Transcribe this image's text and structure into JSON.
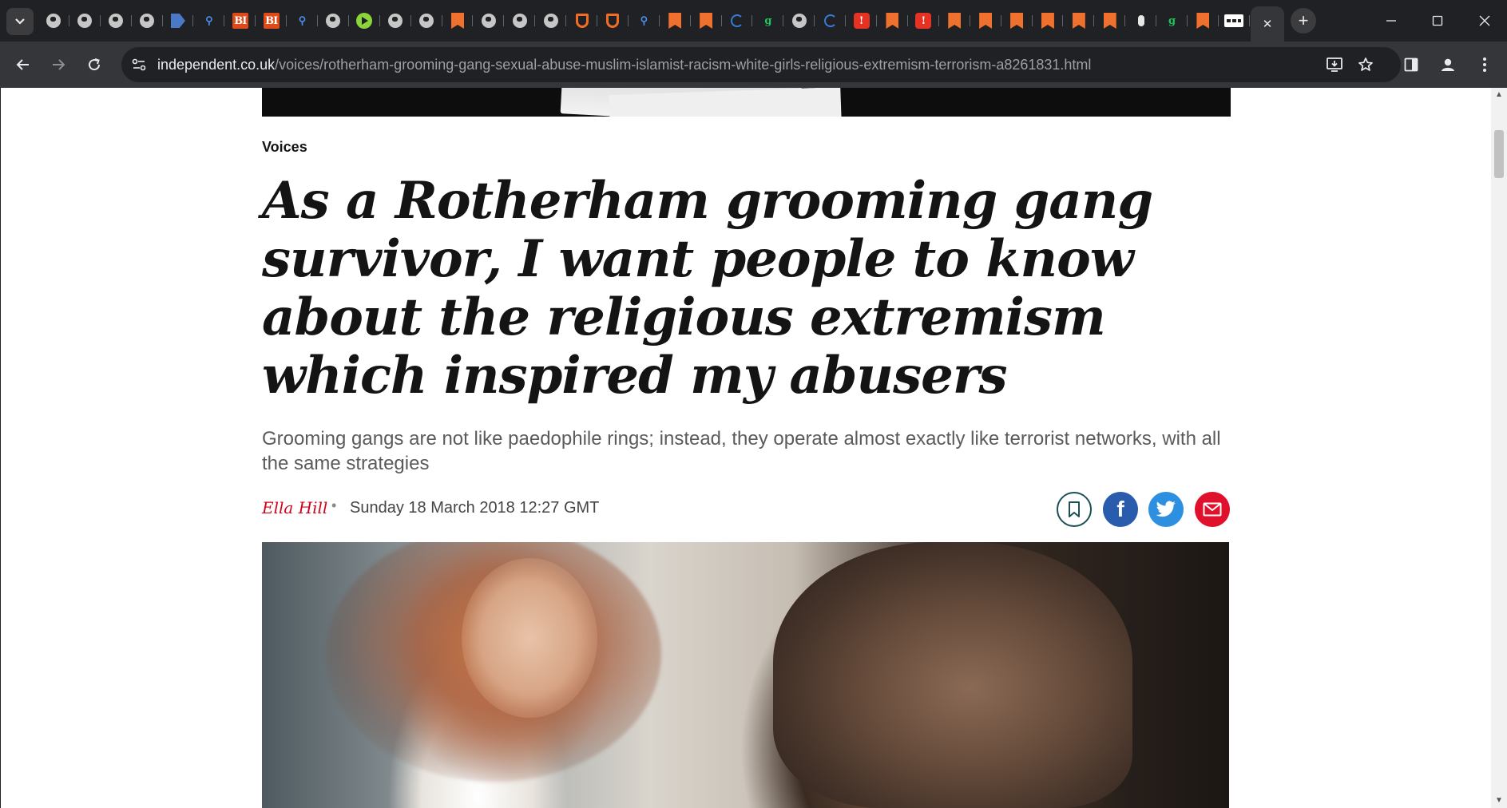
{
  "browser": {
    "pinned_tabs": [
      {
        "icon": "globe-icon"
      },
      {
        "icon": "globe-icon"
      },
      {
        "icon": "globe-icon"
      },
      {
        "icon": "globe-icon"
      },
      {
        "icon": "arrow-icon"
      },
      {
        "icon": "magnifier-icon"
      },
      {
        "icon": "bi-icon",
        "text": "BI"
      },
      {
        "icon": "bi-icon",
        "text": "BI"
      },
      {
        "icon": "magnifier-icon"
      },
      {
        "icon": "globe-icon"
      },
      {
        "icon": "play-icon"
      },
      {
        "icon": "globe-icon"
      },
      {
        "icon": "globe-icon"
      },
      {
        "icon": "bookmark-ribbon-icon"
      },
      {
        "icon": "globe-icon"
      },
      {
        "icon": "globe-icon"
      },
      {
        "icon": "globe-icon"
      },
      {
        "icon": "shield-icon"
      },
      {
        "icon": "shield-icon"
      },
      {
        "icon": "magnifier-icon"
      },
      {
        "icon": "bookmark-ribbon-icon"
      },
      {
        "icon": "bookmark-ribbon-icon"
      },
      {
        "icon": "half-circle-icon"
      },
      {
        "icon": "g-icon",
        "text": "g"
      },
      {
        "icon": "globe-icon"
      },
      {
        "icon": "half-circle-icon"
      },
      {
        "icon": "red-badge-icon",
        "text": "!"
      },
      {
        "icon": "bookmark-ribbon-icon"
      },
      {
        "icon": "red-badge-icon",
        "text": "!"
      },
      {
        "icon": "bookmark-ribbon-icon"
      },
      {
        "icon": "bookmark-ribbon-icon"
      },
      {
        "icon": "bookmark-ribbon-icon"
      },
      {
        "icon": "bookmark-ribbon-icon"
      },
      {
        "icon": "bookmark-ribbon-icon"
      },
      {
        "icon": "bookmark-ribbon-icon"
      },
      {
        "icon": "microphone-icon"
      },
      {
        "icon": "g-icon",
        "text": "g"
      },
      {
        "icon": "bookmark-ribbon-icon"
      },
      {
        "icon": "wide-logo-icon"
      }
    ],
    "active_tab_close": "✕",
    "new_tab_label": "+",
    "window": {
      "minimize": "—",
      "maximize": "☐",
      "close": "✕"
    },
    "url_domain": "independent.co.uk",
    "url_path": "/voices/rotherham-grooming-gang-sexual-abuse-muslim-islamist-racism-white-girls-religious-extremism-terrorism-a8261831.html"
  },
  "article": {
    "kicker": "Voices",
    "headline": "As a Rotherham grooming gang survivor, I want people to know about the religious extremism which inspired my abusers",
    "standfirst": "Grooming gangs are not like paedophile rings; instead, they operate almost exactly like terrorist networks, with all the same strategies",
    "author": "Ella Hill",
    "separator": "•",
    "date": "Sunday 18 March 2018 12:27 GMT",
    "share": {
      "bookmark_icon": "bookmark-icon",
      "facebook_icon": "facebook-icon",
      "facebook_glyph": "f",
      "twitter_icon": "twitter-icon",
      "email_icon": "email-icon"
    }
  },
  "colors": {
    "author": "#d0021b",
    "facebook": "#2a5cad",
    "twitter": "#2c8fe0",
    "email": "#e0112d"
  }
}
